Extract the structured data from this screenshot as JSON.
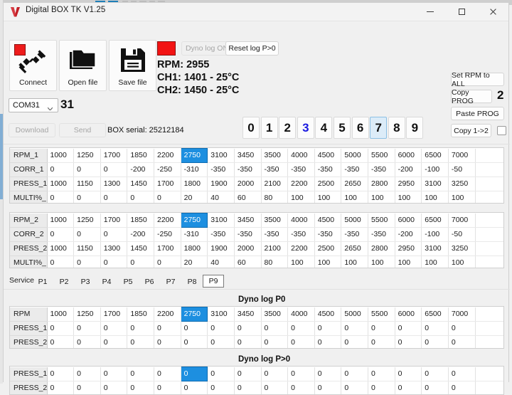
{
  "window": {
    "title": "Digital BOX TK V1.25",
    "minimize": "—",
    "maximize": "□",
    "close": "×"
  },
  "toolbar": {
    "connect_label": "Connect",
    "open_label": "Open file",
    "save_label": "Save file",
    "dyno_log_on": "Dyno log ON",
    "reset_log": "Reset log P>0",
    "rpm_line": "RPM: 2955",
    "ch1_line": "CH1: 1401 - 25°C",
    "ch2_line": "CH2: 1450 - 25°C",
    "status_color": "#f21313"
  },
  "port": {
    "selected": "COM31",
    "number": "31"
  },
  "commands": {
    "download": "Download",
    "send": "Send",
    "box_serial": "BOX serial: 25212184"
  },
  "prog_buttons": {
    "set_rpm_to_all": "Set RPM to ALL",
    "copy_prog": "Copy PROG",
    "copy_prog_value": "2",
    "paste_prog": "Paste PROG",
    "copy_1_2": "Copy 1->2"
  },
  "digits": {
    "items": [
      "0",
      "1",
      "2",
      "3",
      "4",
      "5",
      "6",
      "7",
      "8",
      "9"
    ],
    "highlighted_text": "3",
    "selected": "7",
    "selected_bg": "#dcecf8",
    "selected_border": "#8cc0e4",
    "alt_text_color": "#1a1ae0"
  },
  "selection_color": "#1d8fe0",
  "table1": {
    "rows": [
      {
        "label": "RPM_1",
        "values": [
          "1000",
          "1250",
          "1700",
          "1850",
          "2200",
          "2750",
          "3100",
          "3450",
          "3500",
          "4000",
          "4500",
          "5000",
          "5500",
          "6000",
          "6500",
          "7000"
        ],
        "selected_index": 5
      },
      {
        "label": "CORR_1",
        "values": [
          "0",
          "0",
          "0",
          "-200",
          "-250",
          "-310",
          "-350",
          "-350",
          "-350",
          "-350",
          "-350",
          "-350",
          "-350",
          "-200",
          "-100",
          "-50"
        ],
        "selected_index": -1
      },
      {
        "label": "PRESS_1",
        "values": [
          "1000",
          "1150",
          "1300",
          "1450",
          "1700",
          "1800",
          "1900",
          "2000",
          "2100",
          "2200",
          "2500",
          "2650",
          "2800",
          "2950",
          "3100",
          "3250"
        ],
        "selected_index": -1
      },
      {
        "label": "MULTI%_",
        "values": [
          "0",
          "0",
          "0",
          "0",
          "0",
          "20",
          "40",
          "60",
          "80",
          "100",
          "100",
          "100",
          "100",
          "100",
          "100",
          "100"
        ],
        "selected_index": -1
      }
    ]
  },
  "table2": {
    "rows": [
      {
        "label": "RPM_2",
        "values": [
          "1000",
          "1250",
          "1700",
          "1850",
          "2200",
          "2750",
          "3100",
          "3450",
          "3500",
          "4000",
          "4500",
          "5000",
          "5500",
          "6000",
          "6500",
          "7000"
        ],
        "selected_index": 5
      },
      {
        "label": "CORR_2",
        "values": [
          "0",
          "0",
          "0",
          "-200",
          "-250",
          "-310",
          "-350",
          "-350",
          "-350",
          "-350",
          "-350",
          "-350",
          "-350",
          "-200",
          "-100",
          "-50"
        ],
        "selected_index": -1
      },
      {
        "label": "PRESS_2",
        "values": [
          "1000",
          "1150",
          "1300",
          "1450",
          "1700",
          "1800",
          "1900",
          "2000",
          "2100",
          "2200",
          "2500",
          "2650",
          "2800",
          "2950",
          "3100",
          "3250"
        ],
        "selected_index": -1
      },
      {
        "label": "MULTI%_",
        "values": [
          "0",
          "0",
          "0",
          "0",
          "0",
          "20",
          "40",
          "60",
          "80",
          "100",
          "100",
          "100",
          "100",
          "100",
          "100",
          "100"
        ],
        "selected_index": -1
      }
    ]
  },
  "tabs": {
    "service_label": "Service",
    "items": [
      "P1",
      "P2",
      "P3",
      "P4",
      "P5",
      "P6",
      "P7",
      "P8",
      "P9"
    ],
    "active": "P9"
  },
  "dyno_p0": {
    "title": "Dyno log  P0",
    "rows": [
      {
        "label": "RPM",
        "values": [
          "1000",
          "1250",
          "1700",
          "1850",
          "2200",
          "2750",
          "3100",
          "3450",
          "3500",
          "4000",
          "4500",
          "5000",
          "5500",
          "6000",
          "6500",
          "7000"
        ],
        "selected_index": 5
      },
      {
        "label": "PRESS_1",
        "values": [
          "0",
          "0",
          "0",
          "0",
          "0",
          "0",
          "0",
          "0",
          "0",
          "0",
          "0",
          "0",
          "0",
          "0",
          "0",
          "0"
        ],
        "selected_index": -1
      },
      {
        "label": "PRESS_2",
        "values": [
          "0",
          "0",
          "0",
          "0",
          "0",
          "0",
          "0",
          "0",
          "0",
          "0",
          "0",
          "0",
          "0",
          "0",
          "0",
          "0"
        ],
        "selected_index": -1
      }
    ]
  },
  "dyno_pgt0": {
    "title": "Dyno log  P>0",
    "rows": [
      {
        "label": "PRESS_1",
        "values": [
          "0",
          "0",
          "0",
          "0",
          "0",
          "0",
          "0",
          "0",
          "0",
          "0",
          "0",
          "0",
          "0",
          "0",
          "0",
          "0"
        ],
        "selected_index": 5
      },
      {
        "label": "PRESS_2",
        "values": [
          "0",
          "0",
          "0",
          "0",
          "0",
          "0",
          "0",
          "0",
          "0",
          "0",
          "0",
          "0",
          "0",
          "0",
          "0",
          "0"
        ],
        "selected_index": -1
      }
    ]
  }
}
